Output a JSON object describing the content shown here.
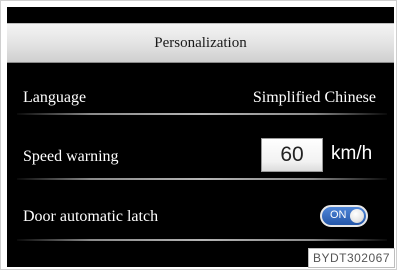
{
  "header": {
    "title": "Personalization"
  },
  "settings": {
    "language": {
      "label": "Language",
      "value": "Simplified Chinese"
    },
    "speed_warning": {
      "label": "Speed warning",
      "value": "60",
      "unit": "km/h"
    },
    "door_automatic_latch": {
      "label": "Door automatic latch",
      "toggle_label": "ON",
      "state": "on"
    }
  },
  "figure_code": "BYDT302067",
  "colors": {
    "screen_background": "#000000",
    "toggle_on": "#2f66c2",
    "text_primary": "#ffffff"
  },
  "icons": {
    "toggle_knob": "toggle-knob-icon"
  }
}
